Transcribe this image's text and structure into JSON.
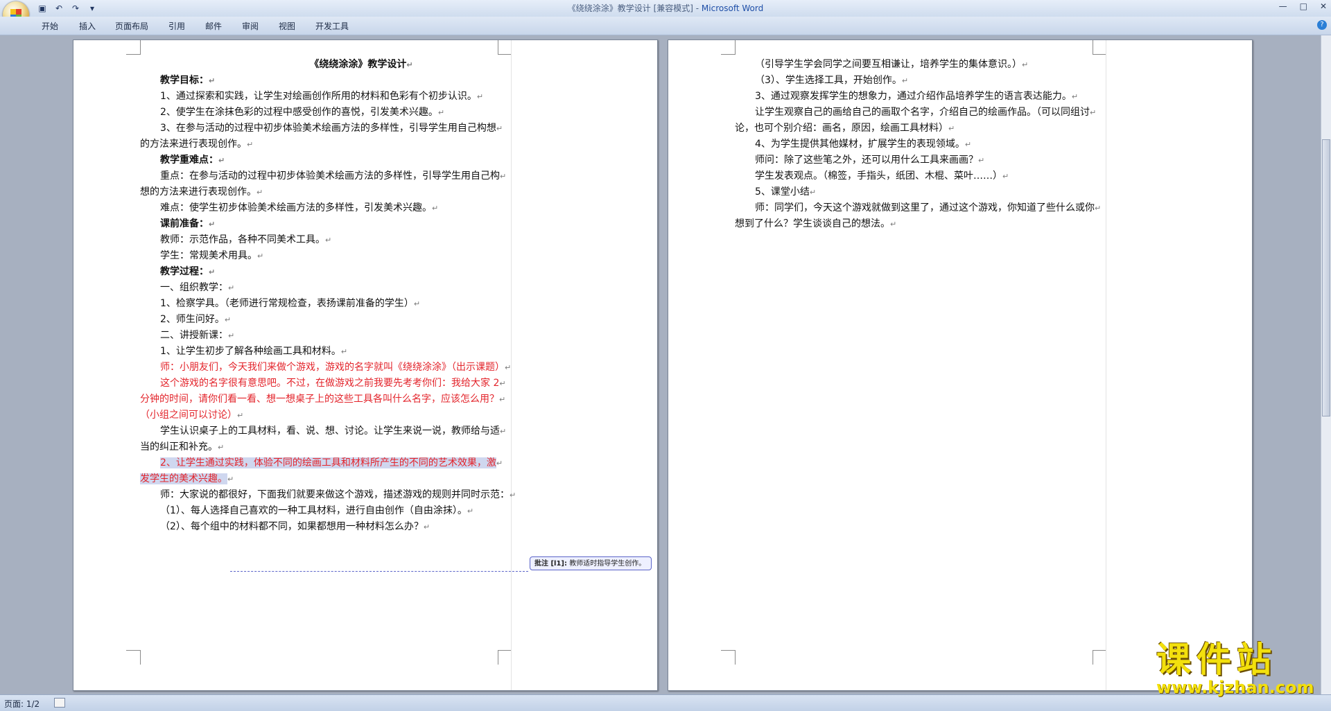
{
  "window": {
    "title": "《绕绕涂涂》教学设计 [兼容模式] - ",
    "app_name": "Microsoft Word",
    "qat_items": [
      "save-icon",
      "undo-icon",
      "redo-icon",
      "customize-icon"
    ]
  },
  "ribbon": {
    "tabs": [
      "开始",
      "插入",
      "页面布局",
      "引用",
      "邮件",
      "审阅",
      "视图",
      "开发工具"
    ]
  },
  "document": {
    "page1": {
      "title": "《绕绕涂涂》教学设计",
      "lines": [
        {
          "text": "教学目标：",
          "style": "bold"
        },
        {
          "text": "1、通过探索和实践，让学生对绘画创作所用的材料和色彩有个初步认识。"
        },
        {
          "text": "2、使学生在涂抹色彩的过程中感受创作的喜悦，引发美术兴趣。"
        },
        {
          "text": "3、在参与活动的过程中初步体验美术绘画方法的多样性，引导学生用自己构想"
        },
        {
          "text": "的方法来进行表现创作。",
          "cont": true
        },
        {
          "text": "教学重难点：",
          "style": "bold"
        },
        {
          "text": "重点：在参与活动的过程中初步体验美术绘画方法的多样性，引导学生用自己构"
        },
        {
          "text": "想的方法来进行表现创作。",
          "cont": true
        },
        {
          "text": "难点：使学生初步体验美术绘画方法的多样性，引发美术兴趣。"
        },
        {
          "text": "课前准备：",
          "style": "bold"
        },
        {
          "text": "教师：示范作品，各种不同美术工具。"
        },
        {
          "text": "学生：常规美术用具。"
        },
        {
          "text": "教学过程：",
          "style": "bold"
        },
        {
          "text": "一、组织教学："
        },
        {
          "text": "1、检察学具。（老师进行常规检查，表扬课前准备的学生）"
        },
        {
          "text": "2、师生问好。"
        },
        {
          "text": "二、讲授新课："
        },
        {
          "text": "1、让学生初步了解各种绘画工具和材料。"
        },
        {
          "text": "师：小朋友们，今天我们来做个游戏，游戏的名字就叫《绕绕涂涂》（出示课题）",
          "style": "red"
        },
        {
          "text": "这个游戏的名字很有意思吧。不过，在做游戏之前我要先考考你们：我给大家 2",
          "style": "red"
        },
        {
          "text": "分钟的时间，请你们看一看、想一想桌子上的这些工具各叫什么名字，应该怎么用？",
          "style": "red",
          "cont": true
        },
        {
          "text": "（小组之间可以讨论）",
          "style": "red",
          "cont": true
        },
        {
          "text": "学生认识桌子上的工具材料，看、说、想、讨论。让学生来说一说，教师给与适"
        },
        {
          "text": "当的纠正和补充。",
          "cont": true
        },
        {
          "text": "2、让学生通过实践，体验不同的绘画工具和材料所产生的不同的艺术效果，激",
          "style": "red-hl"
        },
        {
          "text": "发学生的美术兴趣。",
          "style": "red-hl",
          "cont": true
        },
        {
          "text": "师：大家说的都很好，下面我们就要来做这个游戏，描述游戏的规则并同时示范："
        },
        {
          "text": "（1）、每人选择自己喜欢的一种工具材料，进行自由创作（自由涂抹）。"
        },
        {
          "text": "（2）、每个组中的材料都不同，如果都想用一种材料怎么办？"
        }
      ]
    },
    "page2": {
      "lines": [
        {
          "text": "（引导学生学会同学之间要互相谦让，培养学生的集体意识。）"
        },
        {
          "text": "（3）、学生选择工具，开始创作。"
        },
        {
          "text": "3、通过观察发挥学生的想象力，通过介绍作品培养学生的语言表达能力。"
        },
        {
          "text": "让学生观察自己的画给自己的画取个名字，介绍自己的绘画作品。（可以同组讨"
        },
        {
          "text": "论，也可个别介绍：画名，原因，绘画工具材料）",
          "cont": true
        },
        {
          "text": "4、为学生提供其他媒材，扩展学生的表现领域。"
        },
        {
          "text": "师问：除了这些笔之外，还可以用什么工具来画画？"
        },
        {
          "text": "学生发表观点。（棉签，手指头，纸团、木棍、菜叶……）"
        },
        {
          "text": "5、课堂小结"
        },
        {
          "text": "师：同学们，今天这个游戏就做到这里了，通过这个游戏，你知道了些什么或你"
        },
        {
          "text": "想到了什么？学生谈谈自己的想法。",
          "cont": true
        }
      ]
    },
    "paragraph_mark": "↵",
    "comment": {
      "label": "批注 [l1]:",
      "text": " 教师适时指导学生创作。"
    }
  },
  "statusbar": {
    "page_info": "页面: 1/2"
  },
  "watermark": {
    "brand": "课件站",
    "url": "www.kjzhan.com"
  }
}
